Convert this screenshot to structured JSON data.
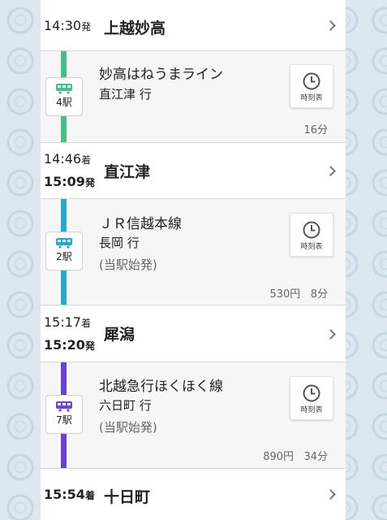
{
  "stations": [
    {
      "arr_time": "",
      "arr_suffix": "",
      "dep_time": "14:30",
      "dep_suffix": "発",
      "name": "上越妙高"
    },
    {
      "arr_time": "14:46",
      "arr_suffix": "着",
      "dep_time": "15:09",
      "dep_suffix": "発",
      "name": "直江津"
    },
    {
      "arr_time": "15:17",
      "arr_suffix": "着",
      "dep_time": "15:20",
      "dep_suffix": "発",
      "name": "犀潟"
    },
    {
      "arr_time": "15:54",
      "arr_suffix": "着",
      "dep_time": "",
      "dep_suffix": "",
      "name": "十日町"
    }
  ],
  "legs": [
    {
      "line": "妙高はねうまライン",
      "direction": "直江津 行",
      "note": "",
      "stops": "4駅",
      "fare": "",
      "duration": "16分",
      "color": "#3cc48a"
    },
    {
      "line": "ＪＲ信越本線",
      "direction": "長岡 行",
      "note": "(当駅始発)",
      "stops": "2駅",
      "fare": "530円",
      "duration": "8分",
      "color": "#1aaed6"
    },
    {
      "line": "北越急行ほくほく線",
      "direction": "六日町 行",
      "note": "(当駅始発)",
      "stops": "7駅",
      "fare": "890円",
      "duration": "34分",
      "color": "#6a3fe0"
    }
  ],
  "timetable_label": "時刻表",
  "icons": {
    "train": "train-icon",
    "clock": "clock-icon",
    "chevron": "chevron-right-icon"
  }
}
